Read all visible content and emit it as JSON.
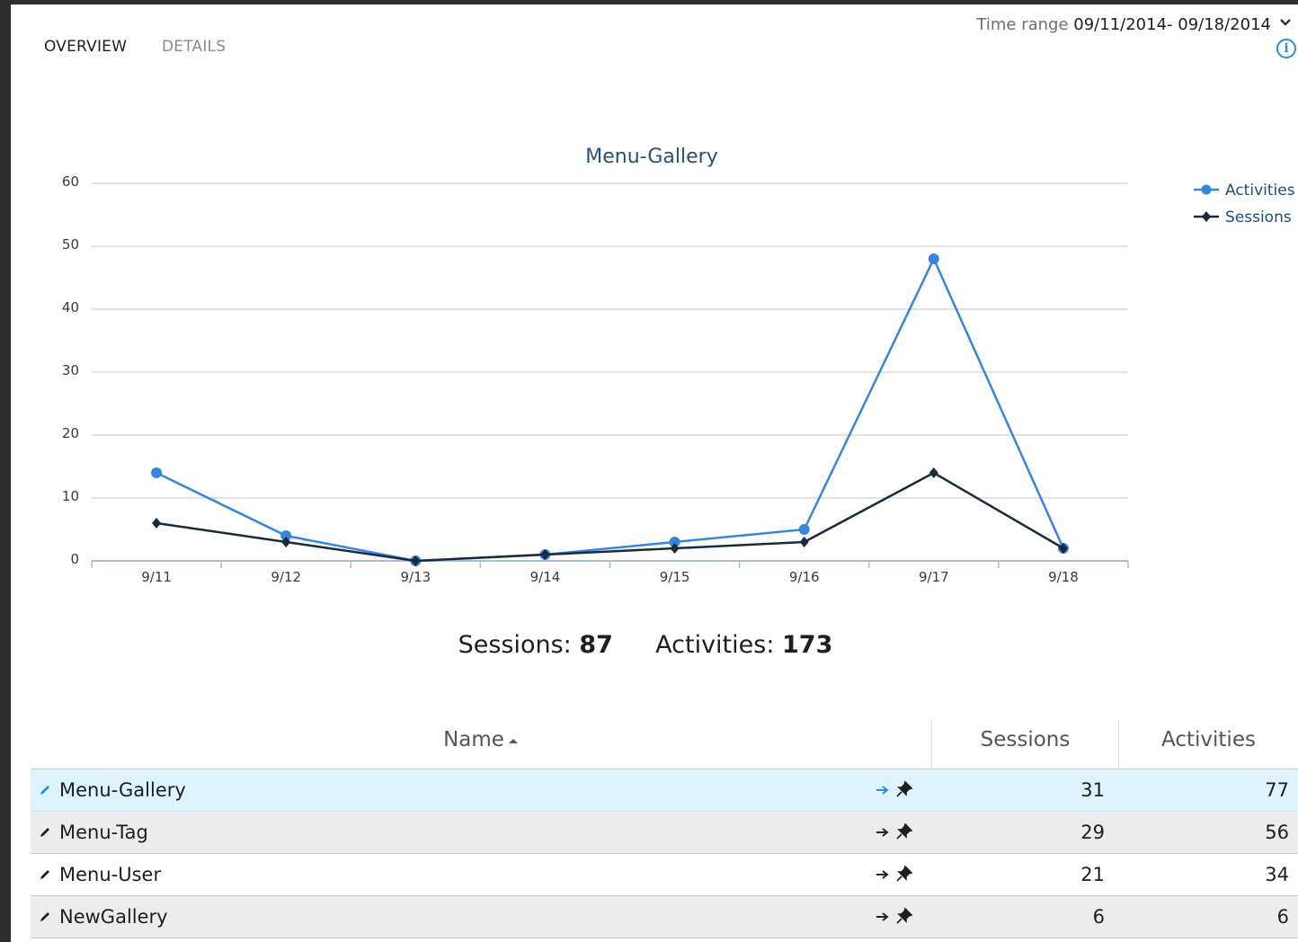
{
  "tabs": [
    {
      "label": "OVERVIEW",
      "active": true
    },
    {
      "label": "DETAILS",
      "active": false
    }
  ],
  "time_range": {
    "label": "Time range",
    "value": "09/11/2014- 09/18/2014"
  },
  "chart_data": {
    "type": "line",
    "title": "Menu-Gallery",
    "categories": [
      "9/11",
      "9/12",
      "9/13",
      "9/14",
      "9/15",
      "9/16",
      "9/17",
      "9/18"
    ],
    "series": [
      {
        "name": "Activities",
        "values": [
          14,
          4,
          0,
          1,
          3,
          5,
          48,
          2
        ],
        "color": "#3586dc",
        "marker": "circle"
      },
      {
        "name": "Sessions",
        "values": [
          6,
          3,
          0,
          1,
          2,
          3,
          14,
          2
        ],
        "color": "#1b2a3a",
        "marker": "diamond"
      }
    ],
    "ylim": [
      0,
      60
    ],
    "yticks": [
      0,
      10,
      20,
      30,
      40,
      50,
      60
    ],
    "grid": true,
    "legend_position": "right"
  },
  "totals": {
    "sessions_label": "Sessions:",
    "sessions_value": "87",
    "activities_label": "Activities:",
    "activities_value": "173"
  },
  "table": {
    "columns": [
      "Name",
      "Sessions",
      "Activities"
    ],
    "sorted_column": "Name",
    "rows": [
      {
        "name": "Menu-Gallery",
        "sessions": "31",
        "activities": "77",
        "selected": true
      },
      {
        "name": "Menu-Tag",
        "sessions": "29",
        "activities": "56",
        "selected": false
      },
      {
        "name": "Menu-User",
        "sessions": "21",
        "activities": "34",
        "selected": false
      },
      {
        "name": "NewGallery",
        "sessions": "6",
        "activities": "6",
        "selected": false
      }
    ]
  },
  "colors": {
    "accent": "#2c8ddf",
    "selected_row": "#def3fd",
    "alt_row": "#ececec"
  }
}
